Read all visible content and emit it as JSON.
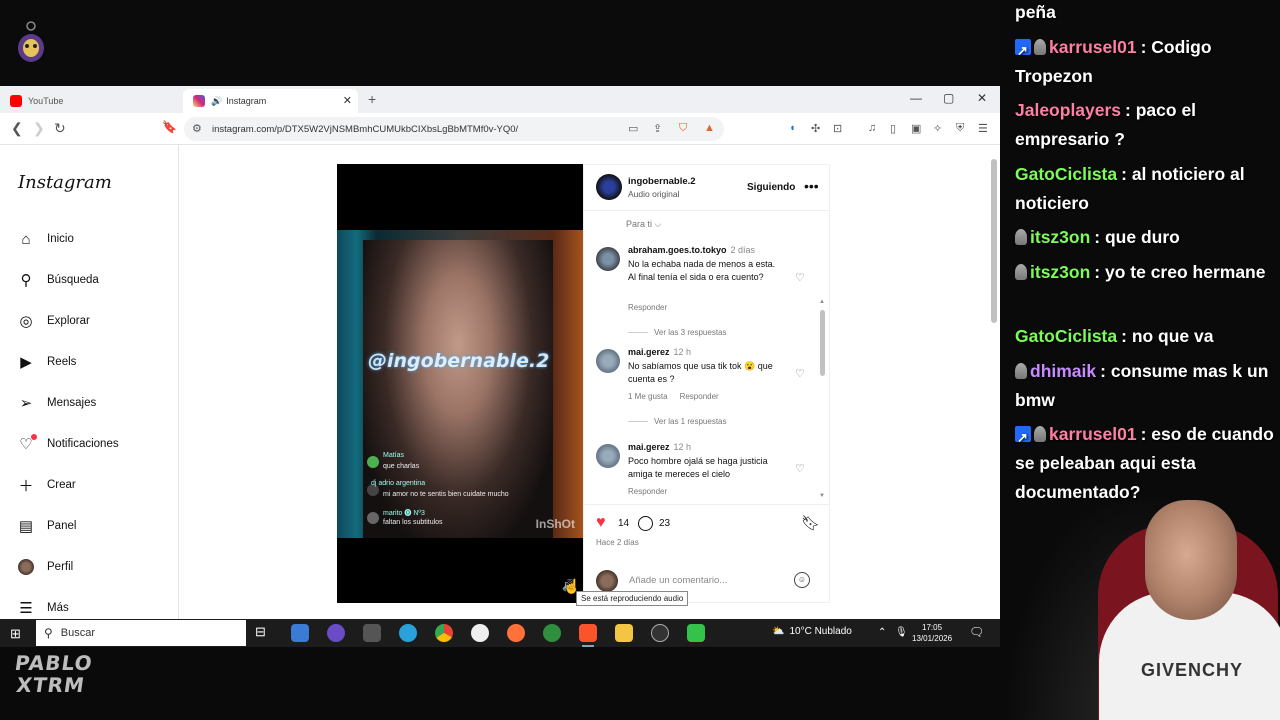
{
  "browser": {
    "tabs": [
      {
        "label": "YouTube",
        "active": false,
        "color": "#ff0000"
      },
      {
        "label": "Instagram",
        "active": true,
        "color": "#d62976"
      }
    ],
    "url": "instagram.com/p/DTX5W2VjNSMBmhCUMUkbCIXbsLgBbMTMf0v-YQ0/",
    "new_tab": "+",
    "win_controls": [
      "—",
      "▢",
      "✕"
    ]
  },
  "instagram": {
    "logo": "Instagram",
    "nav": [
      {
        "label": "Inicio",
        "icon": "home-icon"
      },
      {
        "label": "Búsqueda",
        "icon": "search-icon"
      },
      {
        "label": "Explorar",
        "icon": "compass-icon"
      },
      {
        "label": "Reels",
        "icon": "reels-icon"
      },
      {
        "label": "Mensajes",
        "icon": "send-icon"
      },
      {
        "label": "Notificaciones",
        "icon": "heart-icon"
      },
      {
        "label": "Crear",
        "icon": "plus-icon"
      },
      {
        "label": "Panel",
        "icon": "dashboard-icon"
      },
      {
        "label": "Perfil",
        "icon": "avatar-icon"
      },
      {
        "label": "Más",
        "icon": "menu-icon"
      }
    ],
    "post": {
      "username": "ingobernable.2",
      "audio": "Audio original",
      "follow_label": "Siguiendo",
      "sort_label": "Para ti ⌵",
      "watermark": "@ingobernable.2",
      "video_comments": [
        {
          "user": "Matías",
          "text": "que charlas"
        },
        {
          "user": "dj adrio argentina",
          "text": "mi amor no te sentis bien cuidate mucho"
        },
        {
          "user": "marito 🅞 Nº3",
          "text": "faltan los subtitulos"
        }
      ],
      "video_brand": "InShOt",
      "comments": [
        {
          "user": "abraham.goes.to.tokyo",
          "time": "2 días",
          "text": "No la echaba nada de menos a esta. Al final tenía el sida o era cuento?",
          "reply": "Responder",
          "likes": "",
          "more": "Ver las 3 respuestas"
        },
        {
          "user": "mai.gerez",
          "time": "12 h",
          "text": "No sabíamos que usa tik tok 😮 que cuenta es ?",
          "reply": "Responder",
          "likes": "1 Me gusta",
          "more": "Ver las 1 respuestas"
        },
        {
          "user": "mai.gerez",
          "time": "12 h",
          "text": "Poco hombre ojalá se haga justicia amiga te mereces el cielo",
          "reply": "Responder",
          "likes": "",
          "more": ""
        }
      ],
      "like_count": "14",
      "comment_count": "23",
      "posted": "Hace 2 días",
      "add_comment_placeholder": "Añade un comentario...",
      "tooltip": "Se está reproduciendo audio"
    }
  },
  "taskbar": {
    "search_label": "Buscar",
    "weather": "10°C  Nublado",
    "time": "17:05",
    "date": "13/01/2026"
  },
  "chat": [
    {
      "name": "",
      "name_color": "#ffffff",
      "badges": [],
      "text": "peña"
    },
    {
      "name": "karrusel01",
      "name_color": "#ff7fa4",
      "badges": [
        "prime",
        "hand"
      ],
      "text": ": Codigo Tropezon"
    },
    {
      "name": "Jaleoplayers",
      "name_color": "#ff7fa4",
      "badges": [],
      "text": ": paco el empresario ?"
    },
    {
      "name": "GatoCiclista",
      "name_color": "#7cfc5a",
      "badges": [],
      "text": ": al noticiero al noticiero"
    },
    {
      "name": "itsz3on",
      "name_color": "#7cfc5a",
      "badges": [
        "hand"
      ],
      "text": ": que duro"
    },
    {
      "name": "itsz3on",
      "name_color": "#7cfc5a",
      "badges": [
        "hand"
      ],
      "text": ": yo te creo hermane"
    },
    {
      "name": "GatoCiclista",
      "name_color": "#7cfc5a",
      "badges": [],
      "text": ": no que va"
    },
    {
      "name": "dhimaik",
      "name_color": "#c88aff",
      "badges": [
        "hand"
      ],
      "text": ": consume mas k un bmw"
    },
    {
      "name": "karrusel01",
      "name_color": "#ff7fa4",
      "badges": [
        "prime",
        "hand"
      ],
      "text": ": eso de cuando se peleaban aqui esta documentado?"
    }
  ],
  "stream": {
    "logo_text": "PABLO XTRM"
  },
  "webcam": {
    "shirt_text": "GIVENCHY"
  }
}
